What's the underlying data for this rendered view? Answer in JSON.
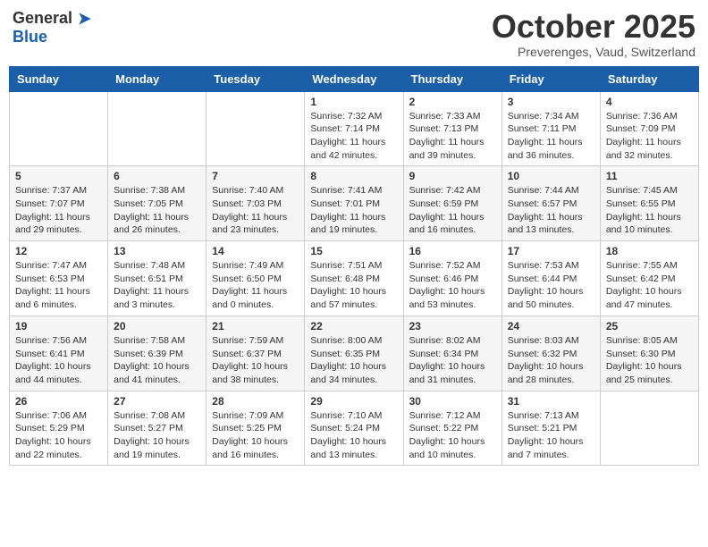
{
  "header": {
    "logo_general": "General",
    "logo_blue": "Blue",
    "month_title": "October 2025",
    "location": "Preverenges, Vaud, Switzerland"
  },
  "days_of_week": [
    "Sunday",
    "Monday",
    "Tuesday",
    "Wednesday",
    "Thursday",
    "Friday",
    "Saturday"
  ],
  "weeks": [
    [
      {
        "day": "",
        "sunrise": "",
        "sunset": "",
        "daylight": ""
      },
      {
        "day": "",
        "sunrise": "",
        "sunset": "",
        "daylight": ""
      },
      {
        "day": "",
        "sunrise": "",
        "sunset": "",
        "daylight": ""
      },
      {
        "day": "1",
        "sunrise": "Sunrise: 7:32 AM",
        "sunset": "Sunset: 7:14 PM",
        "daylight": "Daylight: 11 hours and 42 minutes."
      },
      {
        "day": "2",
        "sunrise": "Sunrise: 7:33 AM",
        "sunset": "Sunset: 7:13 PM",
        "daylight": "Daylight: 11 hours and 39 minutes."
      },
      {
        "day": "3",
        "sunrise": "Sunrise: 7:34 AM",
        "sunset": "Sunset: 7:11 PM",
        "daylight": "Daylight: 11 hours and 36 minutes."
      },
      {
        "day": "4",
        "sunrise": "Sunrise: 7:36 AM",
        "sunset": "Sunset: 7:09 PM",
        "daylight": "Daylight: 11 hours and 32 minutes."
      }
    ],
    [
      {
        "day": "5",
        "sunrise": "Sunrise: 7:37 AM",
        "sunset": "Sunset: 7:07 PM",
        "daylight": "Daylight: 11 hours and 29 minutes."
      },
      {
        "day": "6",
        "sunrise": "Sunrise: 7:38 AM",
        "sunset": "Sunset: 7:05 PM",
        "daylight": "Daylight: 11 hours and 26 minutes."
      },
      {
        "day": "7",
        "sunrise": "Sunrise: 7:40 AM",
        "sunset": "Sunset: 7:03 PM",
        "daylight": "Daylight: 11 hours and 23 minutes."
      },
      {
        "day": "8",
        "sunrise": "Sunrise: 7:41 AM",
        "sunset": "Sunset: 7:01 PM",
        "daylight": "Daylight: 11 hours and 19 minutes."
      },
      {
        "day": "9",
        "sunrise": "Sunrise: 7:42 AM",
        "sunset": "Sunset: 6:59 PM",
        "daylight": "Daylight: 11 hours and 16 minutes."
      },
      {
        "day": "10",
        "sunrise": "Sunrise: 7:44 AM",
        "sunset": "Sunset: 6:57 PM",
        "daylight": "Daylight: 11 hours and 13 minutes."
      },
      {
        "day": "11",
        "sunrise": "Sunrise: 7:45 AM",
        "sunset": "Sunset: 6:55 PM",
        "daylight": "Daylight: 11 hours and 10 minutes."
      }
    ],
    [
      {
        "day": "12",
        "sunrise": "Sunrise: 7:47 AM",
        "sunset": "Sunset: 6:53 PM",
        "daylight": "Daylight: 11 hours and 6 minutes."
      },
      {
        "day": "13",
        "sunrise": "Sunrise: 7:48 AM",
        "sunset": "Sunset: 6:51 PM",
        "daylight": "Daylight: 11 hours and 3 minutes."
      },
      {
        "day": "14",
        "sunrise": "Sunrise: 7:49 AM",
        "sunset": "Sunset: 6:50 PM",
        "daylight": "Daylight: 11 hours and 0 minutes."
      },
      {
        "day": "15",
        "sunrise": "Sunrise: 7:51 AM",
        "sunset": "Sunset: 6:48 PM",
        "daylight": "Daylight: 10 hours and 57 minutes."
      },
      {
        "day": "16",
        "sunrise": "Sunrise: 7:52 AM",
        "sunset": "Sunset: 6:46 PM",
        "daylight": "Daylight: 10 hours and 53 minutes."
      },
      {
        "day": "17",
        "sunrise": "Sunrise: 7:53 AM",
        "sunset": "Sunset: 6:44 PM",
        "daylight": "Daylight: 10 hours and 50 minutes."
      },
      {
        "day": "18",
        "sunrise": "Sunrise: 7:55 AM",
        "sunset": "Sunset: 6:42 PM",
        "daylight": "Daylight: 10 hours and 47 minutes."
      }
    ],
    [
      {
        "day": "19",
        "sunrise": "Sunrise: 7:56 AM",
        "sunset": "Sunset: 6:41 PM",
        "daylight": "Daylight: 10 hours and 44 minutes."
      },
      {
        "day": "20",
        "sunrise": "Sunrise: 7:58 AM",
        "sunset": "Sunset: 6:39 PM",
        "daylight": "Daylight: 10 hours and 41 minutes."
      },
      {
        "day": "21",
        "sunrise": "Sunrise: 7:59 AM",
        "sunset": "Sunset: 6:37 PM",
        "daylight": "Daylight: 10 hours and 38 minutes."
      },
      {
        "day": "22",
        "sunrise": "Sunrise: 8:00 AM",
        "sunset": "Sunset: 6:35 PM",
        "daylight": "Daylight: 10 hours and 34 minutes."
      },
      {
        "day": "23",
        "sunrise": "Sunrise: 8:02 AM",
        "sunset": "Sunset: 6:34 PM",
        "daylight": "Daylight: 10 hours and 31 minutes."
      },
      {
        "day": "24",
        "sunrise": "Sunrise: 8:03 AM",
        "sunset": "Sunset: 6:32 PM",
        "daylight": "Daylight: 10 hours and 28 minutes."
      },
      {
        "day": "25",
        "sunrise": "Sunrise: 8:05 AM",
        "sunset": "Sunset: 6:30 PM",
        "daylight": "Daylight: 10 hours and 25 minutes."
      }
    ],
    [
      {
        "day": "26",
        "sunrise": "Sunrise: 7:06 AM",
        "sunset": "Sunset: 5:29 PM",
        "daylight": "Daylight: 10 hours and 22 minutes."
      },
      {
        "day": "27",
        "sunrise": "Sunrise: 7:08 AM",
        "sunset": "Sunset: 5:27 PM",
        "daylight": "Daylight: 10 hours and 19 minutes."
      },
      {
        "day": "28",
        "sunrise": "Sunrise: 7:09 AM",
        "sunset": "Sunset: 5:25 PM",
        "daylight": "Daylight: 10 hours and 16 minutes."
      },
      {
        "day": "29",
        "sunrise": "Sunrise: 7:10 AM",
        "sunset": "Sunset: 5:24 PM",
        "daylight": "Daylight: 10 hours and 13 minutes."
      },
      {
        "day": "30",
        "sunrise": "Sunrise: 7:12 AM",
        "sunset": "Sunset: 5:22 PM",
        "daylight": "Daylight: 10 hours and 10 minutes."
      },
      {
        "day": "31",
        "sunrise": "Sunrise: 7:13 AM",
        "sunset": "Sunset: 5:21 PM",
        "daylight": "Daylight: 10 hours and 7 minutes."
      },
      {
        "day": "",
        "sunrise": "",
        "sunset": "",
        "daylight": ""
      }
    ]
  ]
}
